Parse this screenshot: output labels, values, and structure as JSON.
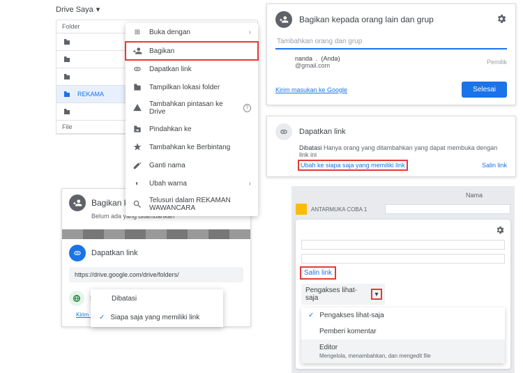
{
  "p1": {
    "drive_title": "Drive Saya",
    "folder_header": "Folder",
    "file_header": "File",
    "folder_selected": "REKAMA",
    "menu": {
      "open_with": "Buka dengan",
      "share": "Bagikan",
      "get_link": "Dapatkan link",
      "show_location": "Tampilkan lokasi folder",
      "add_shortcut": "Tambahkan pintasan ke Drive",
      "move_to": "Pindahkan ke",
      "add_star": "Tambahkan ke Berbintang",
      "rename": "Ganti nama",
      "change_color": "Ubah warna",
      "search_within": "Telusuri dalam REKAMAN WAWANCARA"
    }
  },
  "p2": {
    "title": "Bagikan kepada orang lain dan grup",
    "placeholder": "Tambahkan orang dan grup",
    "user_name": "nanda",
    "you": "(Anda)",
    "email": "@gmail.com",
    "owner": "Pemilik",
    "feedback": "Kirim masukan ke Google",
    "done": "Selesai"
  },
  "p3": {
    "title": "Dapatkan link",
    "restricted_label": "Dibatasi",
    "restricted_text": "Hanya orang yang ditambahkan yang dapat membuka dengan link ini",
    "change": "Ubah ke siapa saja yang memiliki link",
    "copy": "Salin link"
  },
  "p4": {
    "share_title": "Bagikan kepada orang lain dan gr",
    "none_added": "Belum ada yang ditambahkan",
    "getlink_title": "Dapatkan link",
    "url": "https://drive.google.com/drive/folders/",
    "anyone": "Siapa saja yang memiliki link",
    "dd_restricted": "Dibatasi",
    "dd_anyone": "Siapa saja yang memiliki link",
    "feedback": "Kirim m"
  },
  "p5": {
    "name_header": "Nama",
    "folder_label": "ANTARMUKA COBA 1",
    "copy": "Salin link",
    "viewer_label": "Pengakses lihat-saja",
    "role_viewer": "Pengakses lihat-saja",
    "role_commenter": "Pemberi komentar",
    "role_editor": "Editor",
    "role_editor_sub": "Mengelola, menambahkan, dan mengedit file"
  }
}
